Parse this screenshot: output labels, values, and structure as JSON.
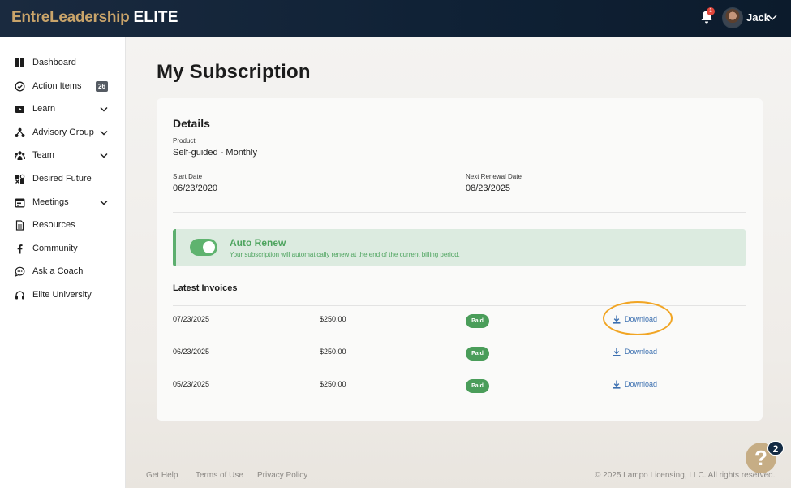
{
  "header": {
    "logo_primary": "EntreLeadership",
    "logo_secondary": "ELITE",
    "notification_count": "1",
    "username": "Jack"
  },
  "sidebar": {
    "items": [
      {
        "label": "Dashboard",
        "icon": "grid-icon"
      },
      {
        "label": "Action Items",
        "icon": "check-circle-icon",
        "badge": "26"
      },
      {
        "label": "Learn",
        "icon": "play-icon",
        "expandable": true
      },
      {
        "label": "Advisory Group",
        "icon": "network-icon",
        "expandable": true
      },
      {
        "label": "Team",
        "icon": "team-icon",
        "expandable": true
      },
      {
        "label": "Desired Future",
        "icon": "puzzle-icon"
      },
      {
        "label": "Meetings",
        "icon": "calendar-icon",
        "expandable": true
      },
      {
        "label": "Resources",
        "icon": "document-icon"
      },
      {
        "label": "Community",
        "icon": "facebook-icon"
      },
      {
        "label": "Ask a Coach",
        "icon": "chat-icon"
      },
      {
        "label": "Elite University",
        "icon": "headset-icon"
      }
    ]
  },
  "main": {
    "title": "My Subscription",
    "details": {
      "heading": "Details",
      "product_label": "Product",
      "product_value": "Self-guided - Monthly",
      "start_label": "Start Date",
      "start_value": "06/23/2020",
      "renewal_label": "Next Renewal Date",
      "renewal_value": "08/23/2025"
    },
    "auto_renew": {
      "title": "Auto Renew",
      "description": "Your subscription will automatically renew at the end of the current billing period.",
      "enabled": true
    },
    "invoices": {
      "heading": "Latest Invoices",
      "rows": [
        {
          "date": "07/23/2025",
          "amount": "$250.00",
          "status": "Paid",
          "action": "Download"
        },
        {
          "date": "06/23/2025",
          "amount": "$250.00",
          "status": "Paid",
          "action": "Download"
        },
        {
          "date": "05/23/2025",
          "amount": "$250.00",
          "status": "Paid",
          "action": "Download"
        }
      ]
    }
  },
  "footer": {
    "links": [
      "Get Help",
      "Terms of Use",
      "Privacy Policy"
    ],
    "copyright": "© 2025 Lampo Licensing, LLC. All rights reserved."
  },
  "help_widget": {
    "icon": "?",
    "count": "2"
  },
  "colors": {
    "brand_gold": "#c9a46a",
    "header_navy": "#0f2135",
    "success_green": "#4ea45f",
    "link_blue": "#3b6fb0",
    "highlight_orange": "#f1a524"
  }
}
